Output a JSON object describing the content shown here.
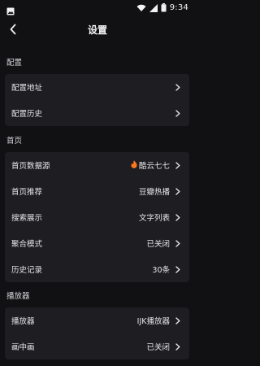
{
  "status": {
    "time": "9:34"
  },
  "appbar": {
    "title": "设置"
  },
  "sections": [
    {
      "label": "配置",
      "items": [
        {
          "label": "配置地址",
          "value": ""
        },
        {
          "label": "配置历史",
          "value": ""
        }
      ]
    },
    {
      "label": "首页",
      "items": [
        {
          "label": "首页数据源",
          "value": "酷云七七",
          "value_icon": "fire-icon"
        },
        {
          "label": "首页推荐",
          "value": "豆瓣热播"
        },
        {
          "label": "搜索展示",
          "value": "文字列表"
        },
        {
          "label": "聚合模式",
          "value": "已关闭"
        },
        {
          "label": "历史记录",
          "value": "30条"
        }
      ]
    },
    {
      "label": "播放器",
      "items": [
        {
          "label": "播放器",
          "value": "IJK播放器"
        },
        {
          "label": "画中画",
          "value": "已关闭"
        }
      ]
    }
  ],
  "colors": {
    "background": "#111114",
    "card": "#1e1e22",
    "text": "#e6e6ea",
    "fire": "#ff7a1a"
  }
}
